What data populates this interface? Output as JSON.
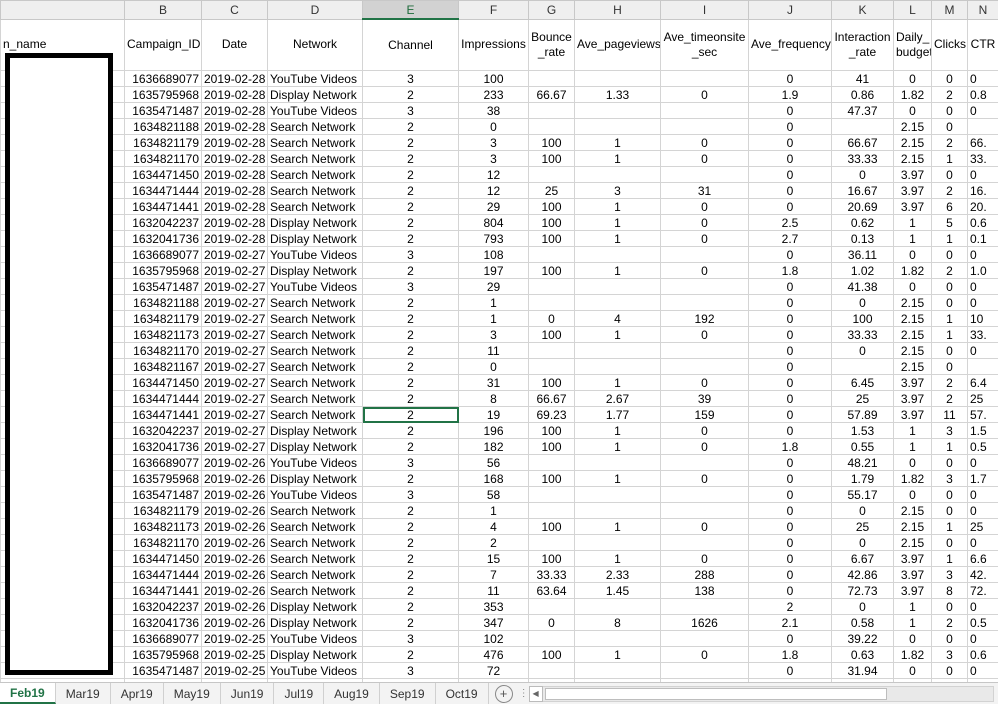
{
  "columns": {
    "letters": [
      "",
      "B",
      "C",
      "D",
      "E",
      "F",
      "G",
      "H",
      "I",
      "J",
      "K",
      "L",
      "M",
      "N"
    ],
    "headers": [
      "n_name",
      "Campaign_ID",
      "Date",
      "Network",
      "Channel",
      "Impressions",
      "Bounce _rate",
      "Ave_pageviews",
      "Ave_timeonsite _sec",
      "Ave_frequency",
      "Interaction _rate",
      "Daily_ budget",
      "Clicks",
      "CTR"
    ]
  },
  "rows": [
    [
      "1636689077",
      "2019-02-28",
      "YouTube Videos",
      "3",
      "100",
      "",
      "",
      "",
      "0",
      "41",
      "0",
      "0",
      "0"
    ],
    [
      "1635795968",
      "2019-02-28",
      "Display Network",
      "2",
      "233",
      "66.67",
      "1.33",
      "0",
      "1.9",
      "0.86",
      "1.82",
      "2",
      "0.8"
    ],
    [
      "1635471487",
      "2019-02-28",
      "YouTube Videos",
      "3",
      "38",
      "",
      "",
      "",
      "0",
      "47.37",
      "0",
      "0",
      "0"
    ],
    [
      "1634821188",
      "2019-02-28",
      "Search Network",
      "2",
      "0",
      "",
      "",
      "",
      "0",
      "",
      "2.15",
      "0",
      ""
    ],
    [
      "1634821179",
      "2019-02-28",
      "Search Network",
      "2",
      "3",
      "100",
      "1",
      "0",
      "0",
      "66.67",
      "2.15",
      "2",
      "66."
    ],
    [
      "1634821170",
      "2019-02-28",
      "Search Network",
      "2",
      "3",
      "100",
      "1",
      "0",
      "0",
      "33.33",
      "2.15",
      "1",
      "33."
    ],
    [
      "1634471450",
      "2019-02-28",
      "Search Network",
      "2",
      "12",
      "",
      "",
      "",
      "0",
      "0",
      "3.97",
      "0",
      "0"
    ],
    [
      "1634471444",
      "2019-02-28",
      "Search Network",
      "2",
      "12",
      "25",
      "3",
      "31",
      "0",
      "16.67",
      "3.97",
      "2",
      "16."
    ],
    [
      "1634471441",
      "2019-02-28",
      "Search Network",
      "2",
      "29",
      "100",
      "1",
      "0",
      "0",
      "20.69",
      "3.97",
      "6",
      "20."
    ],
    [
      "1632042237",
      "2019-02-28",
      "Display Network",
      "2",
      "804",
      "100",
      "1",
      "0",
      "2.5",
      "0.62",
      "1",
      "5",
      "0.6"
    ],
    [
      "1632041736",
      "2019-02-28",
      "Display Network",
      "2",
      "793",
      "100",
      "1",
      "0",
      "2.7",
      "0.13",
      "1",
      "1",
      "0.1"
    ],
    [
      "1636689077",
      "2019-02-27",
      "YouTube Videos",
      "3",
      "108",
      "",
      "",
      "",
      "0",
      "36.11",
      "0",
      "0",
      "0"
    ],
    [
      "1635795968",
      "2019-02-27",
      "Display Network",
      "2",
      "197",
      "100",
      "1",
      "0",
      "1.8",
      "1.02",
      "1.82",
      "2",
      "1.0"
    ],
    [
      "1635471487",
      "2019-02-27",
      "YouTube Videos",
      "3",
      "29",
      "",
      "",
      "",
      "0",
      "41.38",
      "0",
      "0",
      "0"
    ],
    [
      "1634821188",
      "2019-02-27",
      "Search Network",
      "2",
      "1",
      "",
      "",
      "",
      "0",
      "0",
      "2.15",
      "0",
      "0"
    ],
    [
      "1634821179",
      "2019-02-27",
      "Search Network",
      "2",
      "1",
      "0",
      "4",
      "192",
      "0",
      "100",
      "2.15",
      "1",
      "10"
    ],
    [
      "1634821173",
      "2019-02-27",
      "Search Network",
      "2",
      "3",
      "100",
      "1",
      "0",
      "0",
      "33.33",
      "2.15",
      "1",
      "33."
    ],
    [
      "1634821170",
      "2019-02-27",
      "Search Network",
      "2",
      "11",
      "",
      "",
      "",
      "0",
      "0",
      "2.15",
      "0",
      "0"
    ],
    [
      "1634821167",
      "2019-02-27",
      "Search Network",
      "2",
      "0",
      "",
      "",
      "",
      "0",
      "",
      "2.15",
      "0",
      ""
    ],
    [
      "1634471450",
      "2019-02-27",
      "Search Network",
      "2",
      "31",
      "100",
      "1",
      "0",
      "0",
      "6.45",
      "3.97",
      "2",
      "6.4"
    ],
    [
      "1634471444",
      "2019-02-27",
      "Search Network",
      "2",
      "8",
      "66.67",
      "2.67",
      "39",
      "0",
      "25",
      "3.97",
      "2",
      "25"
    ],
    [
      "1634471441",
      "2019-02-27",
      "Search Network",
      "2",
      "19",
      "69.23",
      "1.77",
      "159",
      "0",
      "57.89",
      "3.97",
      "11",
      "57."
    ],
    [
      "1632042237",
      "2019-02-27",
      "Display Network",
      "2",
      "196",
      "100",
      "1",
      "0",
      "0",
      "1.53",
      "1",
      "3",
      "1.5"
    ],
    [
      "1632041736",
      "2019-02-27",
      "Display Network",
      "2",
      "182",
      "100",
      "1",
      "0",
      "1.8",
      "0.55",
      "1",
      "1",
      "0.5"
    ],
    [
      "1636689077",
      "2019-02-26",
      "YouTube Videos",
      "3",
      "56",
      "",
      "",
      "",
      "0",
      "48.21",
      "0",
      "0",
      "0"
    ],
    [
      "1635795968",
      "2019-02-26",
      "Display Network",
      "2",
      "168",
      "100",
      "1",
      "0",
      "0",
      "1.79",
      "1.82",
      "3",
      "1.7"
    ],
    [
      "1635471487",
      "2019-02-26",
      "YouTube Videos",
      "3",
      "58",
      "",
      "",
      "",
      "0",
      "55.17",
      "0",
      "0",
      "0"
    ],
    [
      "1634821179",
      "2019-02-26",
      "Search Network",
      "2",
      "1",
      "",
      "",
      "",
      "0",
      "0",
      "2.15",
      "0",
      "0"
    ],
    [
      "1634821173",
      "2019-02-26",
      "Search Network",
      "2",
      "4",
      "100",
      "1",
      "0",
      "0",
      "25",
      "2.15",
      "1",
      "25"
    ],
    [
      "1634821170",
      "2019-02-26",
      "Search Network",
      "2",
      "2",
      "",
      "",
      "",
      "0",
      "0",
      "2.15",
      "0",
      "0"
    ],
    [
      "1634471450",
      "2019-02-26",
      "Search Network",
      "2",
      "15",
      "100",
      "1",
      "0",
      "0",
      "6.67",
      "3.97",
      "1",
      "6.6"
    ],
    [
      "1634471444",
      "2019-02-26",
      "Search Network",
      "2",
      "7",
      "33.33",
      "2.33",
      "288",
      "0",
      "42.86",
      "3.97",
      "3",
      "42."
    ],
    [
      "1634471441",
      "2019-02-26",
      "Search Network",
      "2",
      "11",
      "63.64",
      "1.45",
      "138",
      "0",
      "72.73",
      "3.97",
      "8",
      "72."
    ],
    [
      "1632042237",
      "2019-02-26",
      "Display Network",
      "2",
      "353",
      "",
      "",
      "",
      "2",
      "0",
      "1",
      "0",
      "0"
    ],
    [
      "1632041736",
      "2019-02-26",
      "Display Network",
      "2",
      "347",
      "0",
      "8",
      "1626",
      "2.1",
      "0.58",
      "1",
      "2",
      "0.5"
    ],
    [
      "1636689077",
      "2019-02-25",
      "YouTube Videos",
      "3",
      "102",
      "",
      "",
      "",
      "0",
      "39.22",
      "0",
      "0",
      "0"
    ],
    [
      "1635795968",
      "2019-02-25",
      "Display Network",
      "2",
      "476",
      "100",
      "1",
      "0",
      "1.8",
      "0.63",
      "1.82",
      "3",
      "0.6"
    ],
    [
      "1635471487",
      "2019-02-25",
      "YouTube Videos",
      "3",
      "72",
      "",
      "",
      "",
      "0",
      "31.94",
      "0",
      "0",
      "0"
    ],
    [
      "1634821182",
      "2019-02-25",
      "Search Network",
      "2",
      "1",
      "",
      "",
      "",
      "0",
      "0",
      "2.15",
      "0",
      "0"
    ]
  ],
  "selected_cell": {
    "row": 21,
    "col": 4
  },
  "sheet_tabs": [
    "Feb19",
    "Mar19",
    "Apr19",
    "May19",
    "Jun19",
    "Jul19",
    "Aug19",
    "Sep19",
    "Oct19"
  ],
  "active_tab": "Feb19",
  "icons": {
    "add_sheet": "plus-circle-icon",
    "splitter": "vertical-ellipsis-icon",
    "scroll_left": "triangle-left-icon"
  },
  "colors": {
    "accent": "#217346",
    "grid": "#d4d4d4",
    "header_bg": "#efefef"
  }
}
